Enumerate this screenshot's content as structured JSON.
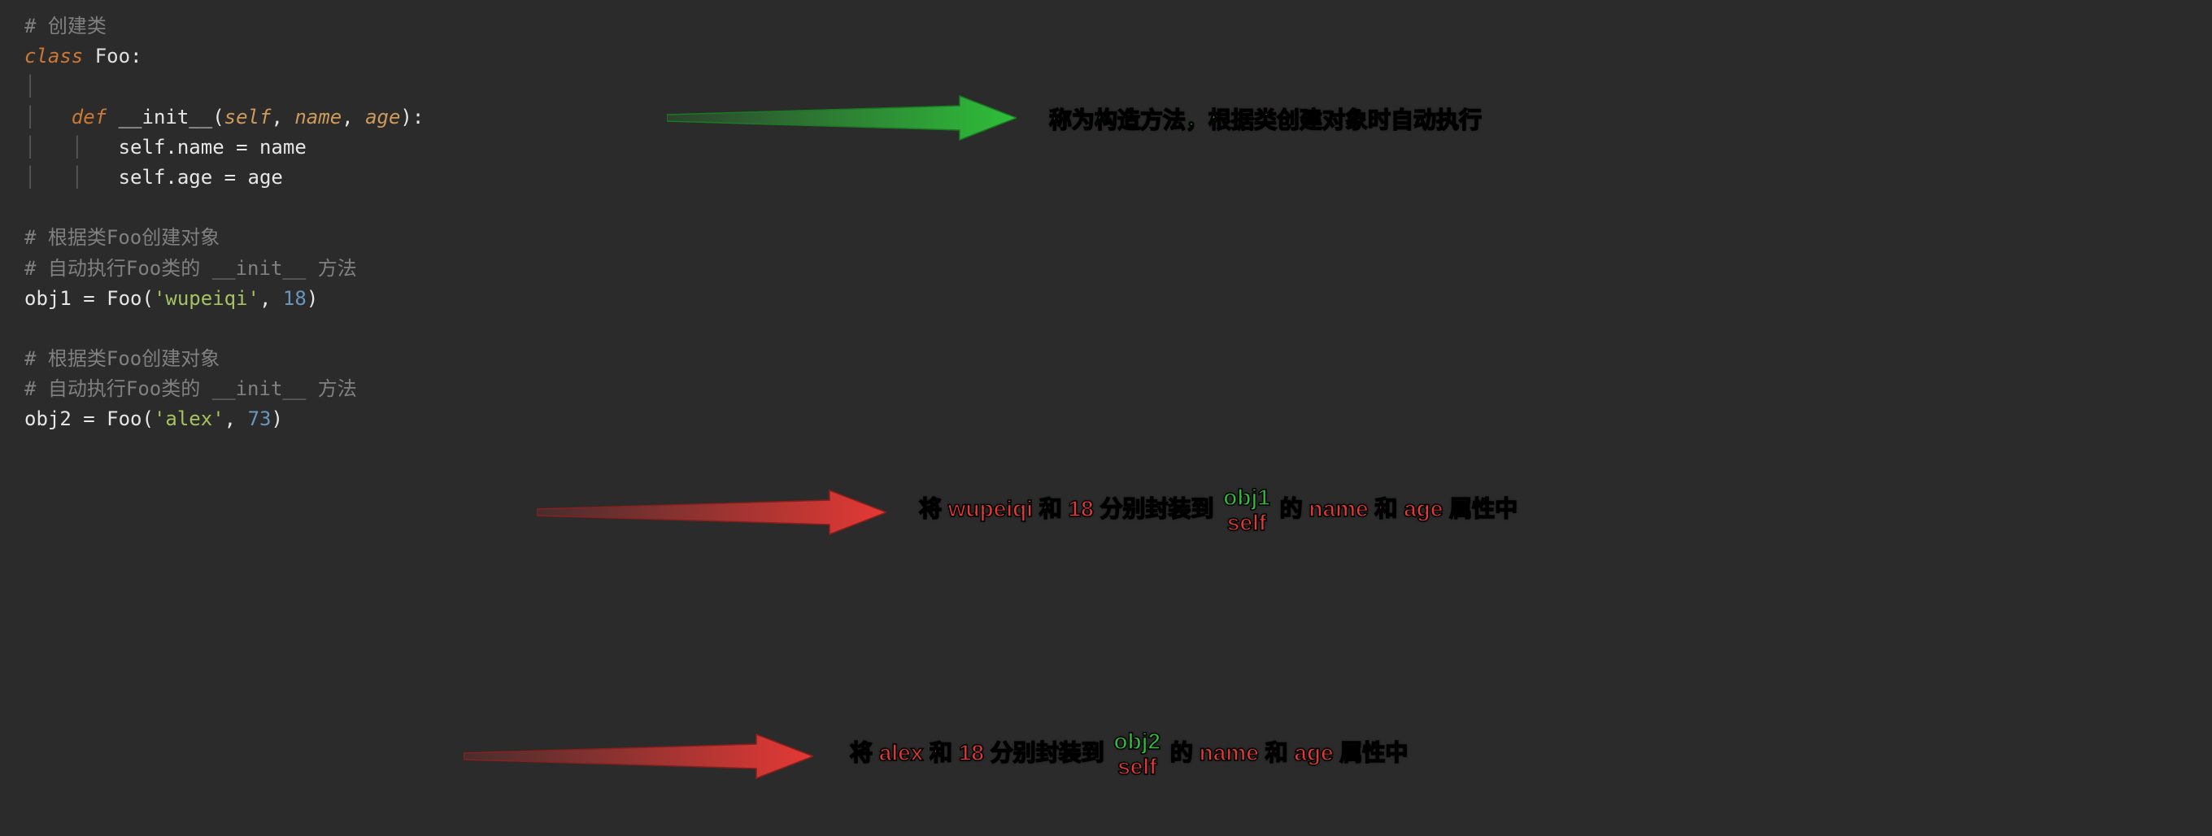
{
  "code": {
    "c1": "# 创建类",
    "kw_class": "class",
    "classname": "Foo",
    "colon": ":",
    "kw_def": "def",
    "init": "__init__",
    "lparen": "(",
    "rparen": "):",
    "p_self": "self",
    "p_name": "name",
    "p_age": "age",
    "comma": ", ",
    "line_self_name": "self.name = name",
    "line_self_age": "self.age = age",
    "c2": "# 根据类Foo创建对象",
    "c3_pre": "# 自动执行Foo类的 ",
    "c3_mid": "__init__",
    "c3_post": " 方法",
    "obj1_lhs": "obj1 = Foo(",
    "obj1_str": "'wupeiqi'",
    "obj1_comma": ", ",
    "obj1_num": "18",
    "obj1_rparen": ")",
    "obj2_lhs": "obj2 = Foo(",
    "obj2_str": "'alex'",
    "obj2_comma": ", ",
    "obj2_num": "73",
    "obj2_rparen": ")"
  },
  "annotations": {
    "a1": "称为构造方法，根据类创建对象时自动执行",
    "a2_pre": "将 wupeiqi 和 18 分别封装到",
    "a2_post": " 的 name 和 age 属性中",
    "a2_top": "obj1",
    "a2_bot": "self",
    "a3_pre": "将 alex 和 18 分别封装到",
    "a3_post": " 的 name 和 age 属性中",
    "a3_top": "obj2",
    "a3_bot": "self"
  }
}
